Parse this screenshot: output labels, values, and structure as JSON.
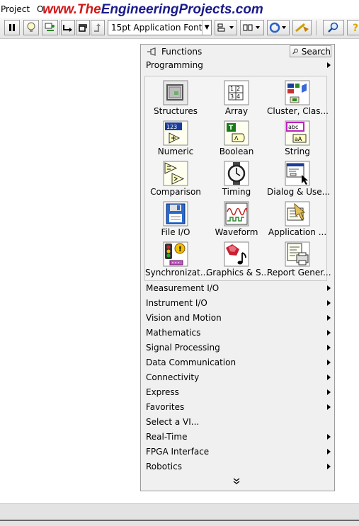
{
  "menubar": {
    "items": [
      "Project",
      "O"
    ]
  },
  "watermark": "www.TheEngineeringProjects.com",
  "toolbar": {
    "font_select": "15pt Application Font",
    "icons": [
      "pause-icon",
      "highlight-bulb-icon",
      "retain-wire-values-icon",
      "step-into-icon",
      "step-over-icon",
      "step-out-icon",
      "align-objects-icon",
      "distribute-objects-icon",
      "reorder-icon",
      "cleanup-diagram-icon",
      "zoom-search-icon",
      "context-help-icon"
    ]
  },
  "palette": {
    "title": "Functions",
    "search_label": "Search",
    "programming_label": "Programming",
    "tiles": [
      {
        "label": "Structures",
        "icon": "structures-icon"
      },
      {
        "label": "Array",
        "icon": "array-icon"
      },
      {
        "label": "Cluster, Clas...",
        "icon": "cluster-icon"
      },
      {
        "label": "Numeric",
        "icon": "numeric-icon"
      },
      {
        "label": "Boolean",
        "icon": "boolean-icon"
      },
      {
        "label": "String",
        "icon": "string-icon"
      },
      {
        "label": "Comparison",
        "icon": "comparison-icon"
      },
      {
        "label": "Timing",
        "icon": "timing-watch-icon"
      },
      {
        "label": "Dialog & Use...",
        "icon": "dialog-icon"
      },
      {
        "label": "File I/O",
        "icon": "file-io-floppy-icon"
      },
      {
        "label": "Waveform",
        "icon": "waveform-icon"
      },
      {
        "label": "Application ...",
        "icon": "application-control-icon"
      },
      {
        "label": "Synchronizat...",
        "icon": "synchronization-icon"
      },
      {
        "label": "Graphics & S...",
        "icon": "graphics-sound-icon"
      },
      {
        "label": "Report Gener...",
        "icon": "report-generation-icon"
      }
    ],
    "categories": [
      {
        "label": "Measurement I/O",
        "arrow": true
      },
      {
        "label": "Instrument I/O",
        "arrow": true
      },
      {
        "label": "Vision and Motion",
        "arrow": true
      },
      {
        "label": "Mathematics",
        "arrow": true
      },
      {
        "label": "Signal Processing",
        "arrow": true
      },
      {
        "label": "Data Communication",
        "arrow": true
      },
      {
        "label": "Connectivity",
        "arrow": true
      },
      {
        "label": "Express",
        "arrow": true
      },
      {
        "label": "Favorites",
        "arrow": true
      },
      {
        "label": "Select a VI...",
        "arrow": false
      },
      {
        "label": "Real-Time",
        "arrow": true
      },
      {
        "label": "FPGA Interface",
        "arrow": true
      },
      {
        "label": "Robotics",
        "arrow": true
      }
    ]
  }
}
